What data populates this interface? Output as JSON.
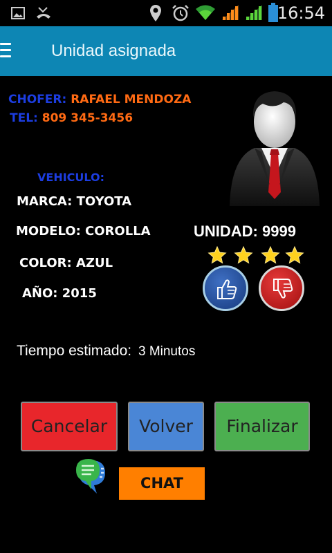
{
  "status_bar": {
    "time": "16:54",
    "icons": [
      "image-icon",
      "missed-call-icon",
      "location-icon",
      "alarm-icon",
      "wifi-icon",
      "signal-icon",
      "signal-icon",
      "battery-icon"
    ]
  },
  "header": {
    "title": "Unidad asignada",
    "menu_icon": "hamburger-menu-icon",
    "background": "#0d86b4"
  },
  "driver": {
    "label": "CHOFER:",
    "name": "RAFAEL MENDOZA",
    "phone_label": "TEL:",
    "phone": "809 345-3456"
  },
  "vehicle": {
    "section_label": "VEHICULO:",
    "brand": "MARCA: TOYOTA",
    "model": "MODELO: COROLLA",
    "color": "COLOR: AZUL",
    "year": "AÑO: 2015"
  },
  "unit": "UNIDAD: 9999",
  "rating": {
    "stars": 4,
    "max": 4
  },
  "eta": {
    "label": "Tiempo estimado:",
    "value": "3 Minutos"
  },
  "actions": {
    "cancel": "Cancelar",
    "back": "Volver",
    "finish": "Finalizar",
    "chat": "CHAT"
  },
  "colors": {
    "label_blue": "#1c3de0",
    "value_orange": "#ff6a13",
    "cancel": "#e8262b",
    "back": "#4a86d6",
    "finish": "#4caf50",
    "chat": "#ff7f00"
  }
}
